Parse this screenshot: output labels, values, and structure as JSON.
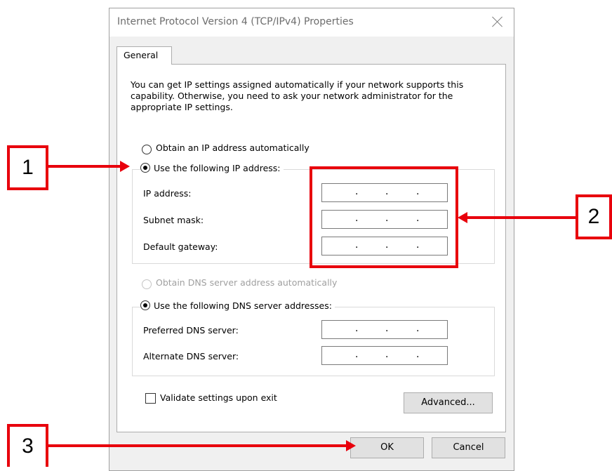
{
  "window": {
    "title": "Internet Protocol Version 4 (TCP/IPv4) Properties"
  },
  "tabs": [
    {
      "label": "General"
    }
  ],
  "intro_text": "You can get IP settings assigned automatically if your network supports this capability. Otherwise, you need to ask your network administrator for the appropriate IP settings.",
  "ip_section": {
    "auto_label": "Obtain an IP address automatically",
    "manual_label": "Use the following IP address:",
    "selected": "manual",
    "fields": [
      {
        "label": "IP address:",
        "value": ". . ."
      },
      {
        "label": "Subnet mask:",
        "value": ". . ."
      },
      {
        "label": "Default gateway:",
        "value": ". . ."
      }
    ]
  },
  "dns_section": {
    "auto_label": "Obtain DNS server address automatically",
    "auto_disabled": true,
    "manual_label": "Use the following DNS server addresses:",
    "selected": "manual",
    "fields": [
      {
        "label": "Preferred DNS server:",
        "value": ". . ."
      },
      {
        "label": "Alternate DNS server:",
        "value": ". . ."
      }
    ]
  },
  "validate_label": "Validate settings upon exit",
  "validate_checked": false,
  "buttons": {
    "advanced": "Advanced...",
    "ok": "OK",
    "cancel": "Cancel"
  },
  "annotations": [
    {
      "number": "1"
    },
    {
      "number": "2"
    },
    {
      "number": "3"
    }
  ],
  "colors": {
    "annotation": "#e8000c",
    "dialog_bg": "#f0f0f0",
    "panel_bg": "#ffffff"
  }
}
